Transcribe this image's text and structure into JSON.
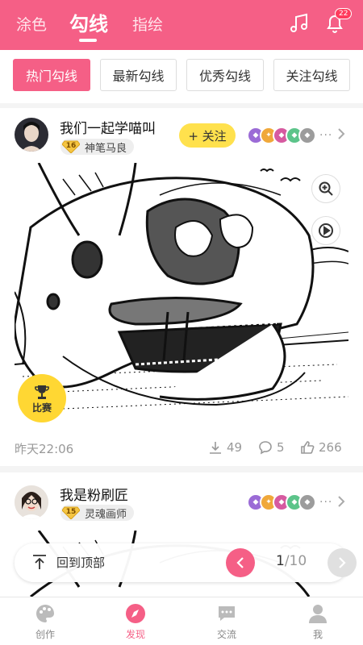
{
  "header": {
    "tabs": [
      {
        "label": "涂色"
      },
      {
        "label": "勾线"
      },
      {
        "label": "指绘"
      }
    ],
    "active_tab": "勾线",
    "notification_count": "22",
    "accent_color": "#f55f86"
  },
  "filters": [
    {
      "label": "热门勾线",
      "active": true
    },
    {
      "label": "最新勾线",
      "active": false
    },
    {
      "label": "优秀勾线",
      "active": false
    },
    {
      "label": "关注勾线",
      "active": false
    }
  ],
  "posts": [
    {
      "username": "我们一起学喵叫",
      "level": "16",
      "title": "神笔马良",
      "follow_label": "+ 关注",
      "badges_more": "···",
      "contest_label": "比赛",
      "timestamp": "昨天22:06",
      "downloads": "49",
      "comments": "5",
      "likes": "266"
    },
    {
      "username": "我是粉刷匠",
      "level": "15",
      "title": "灵魂画师",
      "badges_more": "···"
    }
  ],
  "pager": {
    "back_to_top": "回到顶部",
    "current": "1",
    "total": "/10"
  },
  "bottom_nav": [
    {
      "label": "创作",
      "icon": "palette-icon"
    },
    {
      "label": "发现",
      "icon": "compass-icon"
    },
    {
      "label": "交流",
      "icon": "chat-icon"
    },
    {
      "label": "我",
      "icon": "person-icon"
    }
  ]
}
